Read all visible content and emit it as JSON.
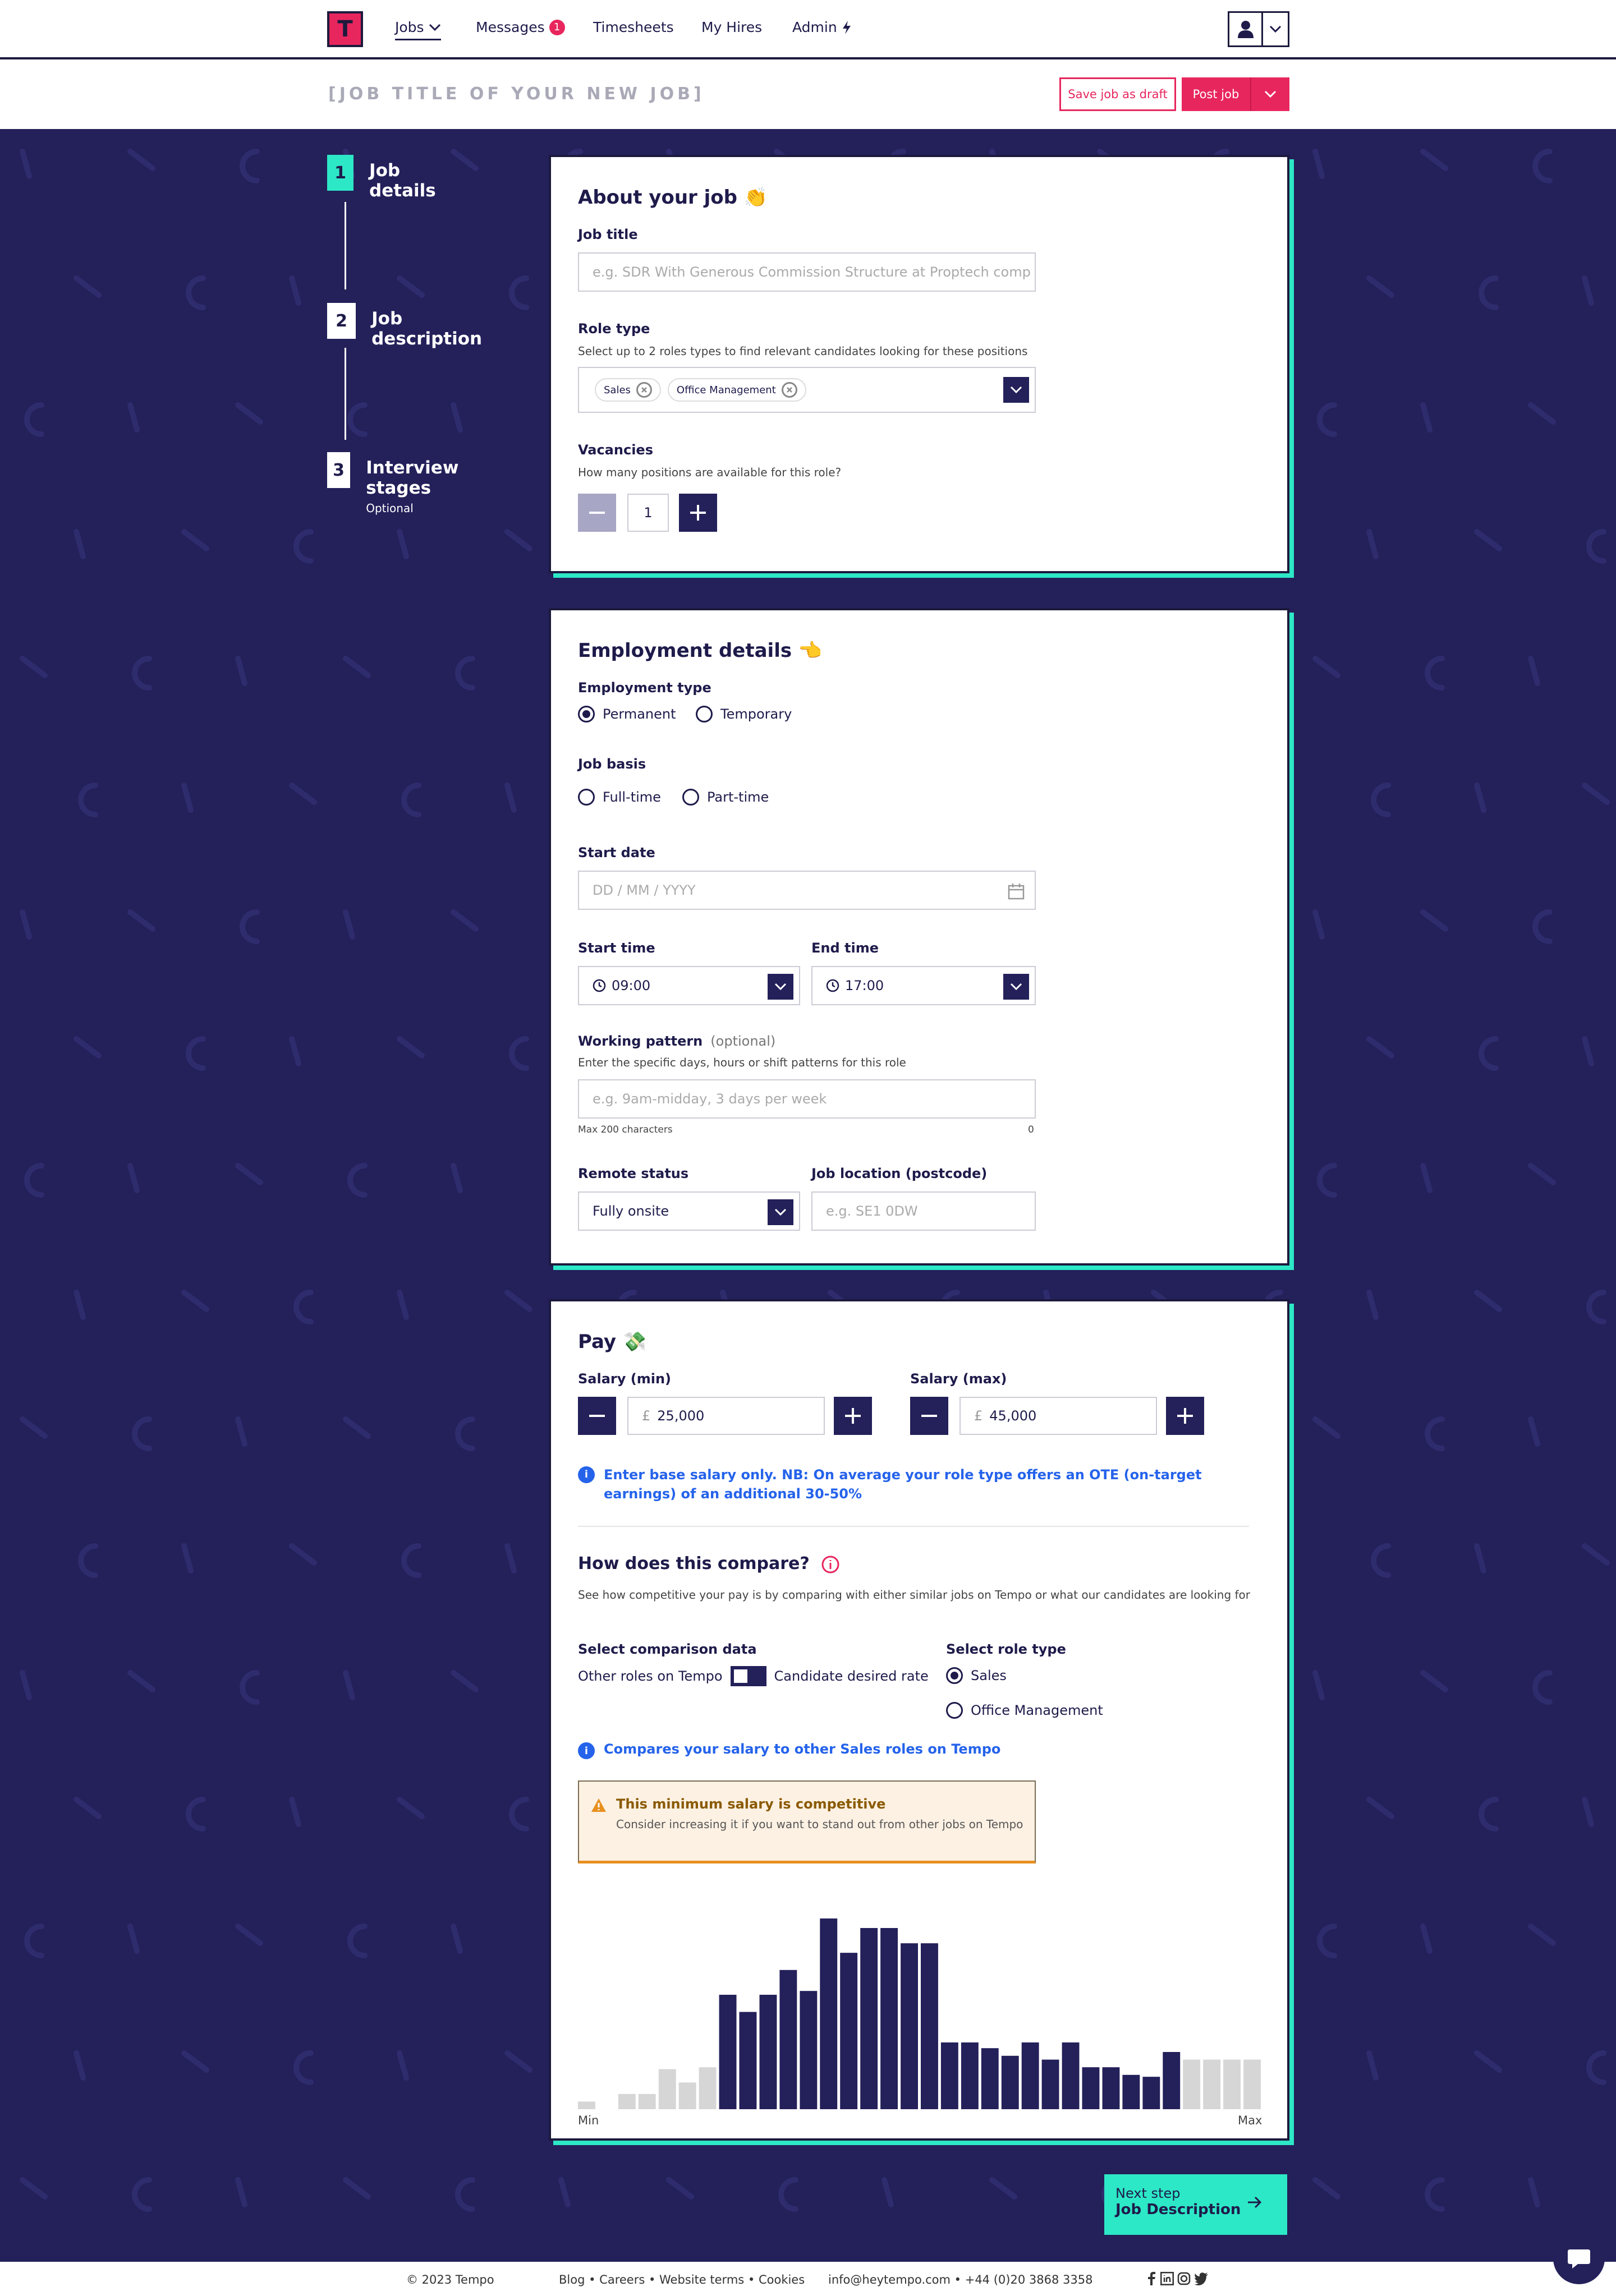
{
  "header": {
    "logo_letter": "T",
    "nav": [
      {
        "label": "Jobs",
        "active": true
      },
      {
        "label": "Messages",
        "badge": "1"
      },
      {
        "label": "Timesheets"
      },
      {
        "label": "My Hires"
      },
      {
        "label": "Admin"
      }
    ]
  },
  "title_bar": {
    "job_title_placeholder": "[JOB TITLE OF YOUR NEW JOB]",
    "save_draft": "Save job as draft",
    "post_job": "Post job"
  },
  "steps": [
    {
      "num": "1",
      "label": "Job details",
      "active": true
    },
    {
      "num": "2",
      "label": "Job description"
    },
    {
      "num": "3",
      "label": "Interview stages",
      "sub": "Optional"
    }
  ],
  "about": {
    "heading": "About your job 👏",
    "job_title_label": "Job title",
    "job_title_placeholder": "e.g. SDR With Generous Commission Structure at Proptech comp",
    "role_type_label": "Role type",
    "role_type_help": "Select up to 2 roles types to find relevant candidates looking for these positions",
    "role_tags": [
      "Sales",
      "Office Management"
    ],
    "vacancies_label": "Vacancies",
    "vacancies_help": "How many positions are available for this role?",
    "vacancies_value": "1"
  },
  "employment": {
    "heading": "Employment details 👈",
    "employment_type_label": "Employment type",
    "employment_types": [
      {
        "label": "Permanent",
        "checked": true
      },
      {
        "label": "Temporary",
        "checked": false
      }
    ],
    "job_basis_label": "Job basis",
    "job_basis": [
      {
        "label": "Full-time",
        "checked": false
      },
      {
        "label": "Part-time",
        "checked": false
      }
    ],
    "start_date_label": "Start date",
    "start_date_placeholder": "DD / MM / YYYY",
    "start_time_label": "Start time",
    "start_time_value": "09:00",
    "end_time_label": "End time",
    "end_time_value": "17:00",
    "working_pattern_label": "Working pattern",
    "working_pattern_optional": "(optional)",
    "working_pattern_help": "Enter the specific days, hours or shift patterns for this role",
    "working_pattern_placeholder": "e.g. 9am-midday, 3 days per week",
    "max_chars": "Max 200 characters",
    "char_count": "0",
    "remote_label": "Remote status",
    "remote_value": "Fully onsite",
    "location_label": "Job location (postcode)",
    "location_placeholder": "e.g. SE1 0DW"
  },
  "pay": {
    "heading": "Pay 💸",
    "salary_min_label": "Salary (min)",
    "salary_min_value": "25,000",
    "salary_max_label": "Salary (max)",
    "salary_max_value": "45,000",
    "currency": "£",
    "base_note": "Enter base salary only. NB: On average your role type offers an OTE (on-target earnings) of an additional 30-50%",
    "compare_heading": "How does this compare?",
    "compare_help": "See how competitive your pay is by comparing with either similar jobs on Tempo or what our candidates are looking for",
    "comparison_label": "Select comparison data",
    "comparison_left": "Other roles on Tempo",
    "comparison_right": "Candidate desired rate",
    "role_select_label": "Select role type",
    "role_options": [
      {
        "label": "Sales",
        "checked": true
      },
      {
        "label": "Office Management",
        "checked": false
      }
    ],
    "compare_note": "Compares your salary to other Sales roles on Tempo",
    "warning_title": "This minimum salary is competitive",
    "warning_desc": "Consider increasing it if you want to stand out from other jobs on Tempo"
  },
  "chart_data": {
    "type": "bar",
    "xlabel_min": "Min",
    "xlabel_max": "Max",
    "values": [
      4,
      0,
      8,
      8,
      21,
      14,
      22,
      60,
      51,
      60,
      73,
      62,
      100,
      82,
      95,
      95,
      87,
      87,
      35,
      35,
      32,
      28,
      35,
      26,
      35,
      22,
      22,
      18,
      17,
      30,
      26,
      26,
      26,
      26
    ],
    "highlighted": [
      false,
      false,
      false,
      false,
      false,
      false,
      false,
      true,
      true,
      true,
      true,
      true,
      true,
      true,
      true,
      true,
      true,
      true,
      true,
      true,
      true,
      true,
      true,
      true,
      true,
      true,
      true,
      true,
      true,
      true,
      false,
      false,
      false,
      false
    ],
    "colors": {
      "highlight": "#23205a",
      "muted": "#d6d6d6"
    }
  },
  "next_step": {
    "top": "Next step",
    "bottom": "Job Description"
  },
  "footer": {
    "copyright": "© 2023 Tempo",
    "links": "Blog • Careers • Website terms • Cookies",
    "contact": "info@heytempo.com • +44 (0)20 3868 3358"
  },
  "colors": {
    "accent": "#2de8c6",
    "brand": "#e8265e",
    "navy": "#23205a"
  }
}
